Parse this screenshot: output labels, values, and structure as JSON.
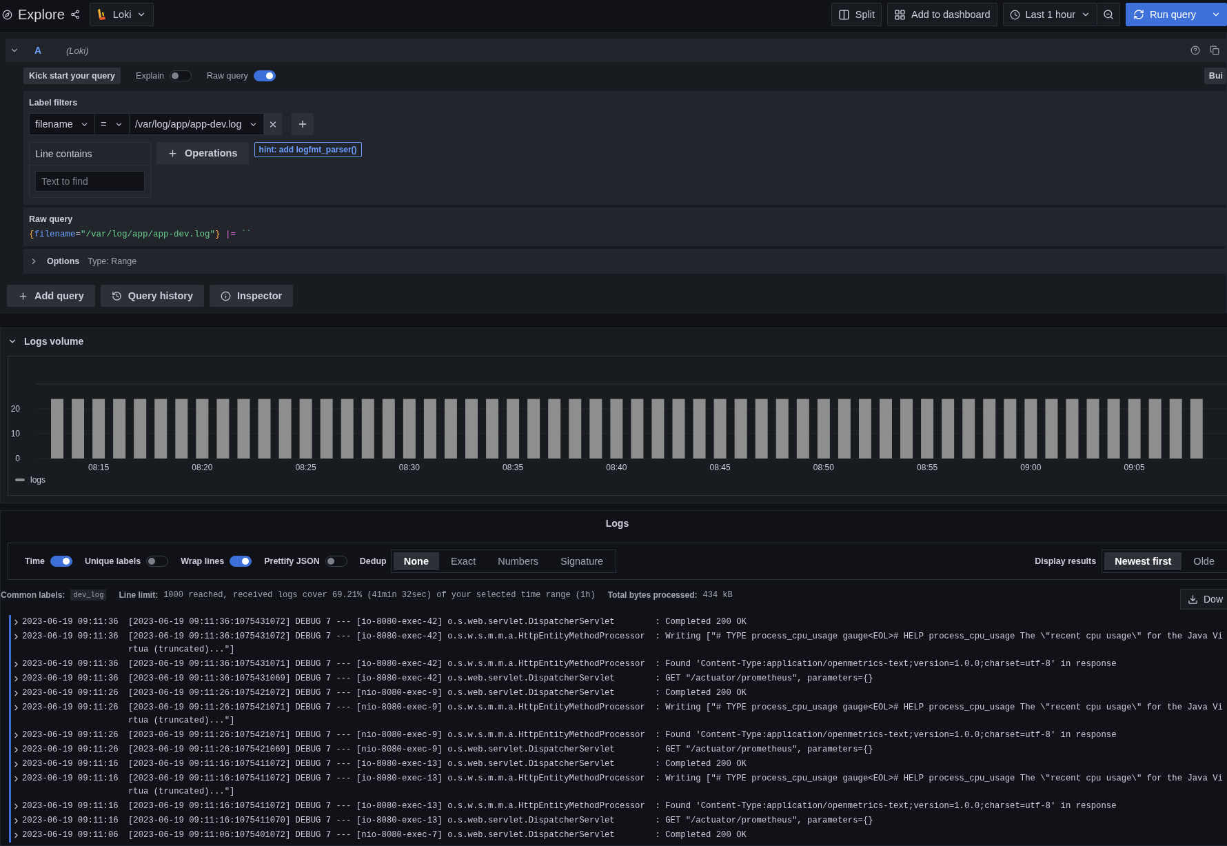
{
  "toolbar": {
    "title": "Explore",
    "datasource": "Loki",
    "buttons": [
      {
        "kind": "split",
        "label": "Split"
      },
      {
        "kind": "dashboard",
        "label": "Add to dashboard"
      },
      {
        "kind": "time",
        "label": "Last 1 hour"
      }
    ],
    "run_label": "Run query"
  },
  "query": {
    "ref": "A",
    "datasource": "(Loki)",
    "kickstart": "Kick start your query",
    "toggles": [
      {
        "label": "Explain",
        "on": false
      },
      {
        "label": "Raw query",
        "on": true
      }
    ],
    "mode_button": "Bui",
    "label_filters": {
      "title": "Label filters",
      "label": "filename",
      "operator": "=",
      "value": "/var/log/app/app-dev.log"
    },
    "line_contains": {
      "title": "Line contains",
      "placeholder": "Text to find"
    },
    "operations": "Operations",
    "hint": "hint: add logfmt_parser()",
    "raw_query": {
      "title": "Raw query",
      "tokens": [
        {
          "kind": "brace",
          "text": "{"
        },
        {
          "kind": "label",
          "text": "filename"
        },
        {
          "kind": "op",
          "text": "="
        },
        {
          "kind": "string",
          "text": "\"/var/log/app/app-dev.log\""
        },
        {
          "kind": "brace",
          "text": "}"
        },
        {
          "kind": "pipe",
          "text": "|="
        },
        {
          "kind": "string",
          "text": "``"
        }
      ]
    },
    "options": {
      "title": "Options",
      "summary": "Type: Range",
      "expanded": false
    }
  },
  "actions": [
    {
      "kind": "add",
      "label": "Add query"
    },
    {
      "kind": "history",
      "label": "Query history"
    },
    {
      "kind": "info",
      "label": "Inspector"
    }
  ],
  "logs_volume": {
    "title": "Logs volume",
    "expanded": true,
    "chart_data": {
      "type": "bar",
      "categories": [
        null,
        null,
        "08:15",
        null,
        null,
        null,
        null,
        "08:20",
        null,
        null,
        null,
        null,
        "08:25",
        null,
        null,
        null,
        null,
        "08:30",
        null,
        null,
        null,
        null,
        "08:35",
        null,
        null,
        null,
        null,
        "08:40",
        null,
        null,
        null,
        null,
        "08:45",
        null,
        null,
        null,
        null,
        "08:50",
        null,
        null,
        null,
        null,
        "08:55",
        null,
        null,
        null,
        null,
        "09:00",
        null,
        null,
        null,
        null,
        "09:05",
        null,
        null,
        null
      ],
      "series": [
        {
          "name": "logs",
          "color": "#8e8e8e",
          "values": [
            24,
            24,
            24,
            24,
            24,
            24,
            24,
            24,
            24,
            24,
            24,
            24,
            24,
            24,
            24,
            24,
            24,
            24,
            24,
            24,
            24,
            24,
            24,
            24,
            24,
            24,
            24,
            24,
            24,
            24,
            24,
            24,
            24,
            24,
            24,
            24,
            24,
            24,
            24,
            24,
            24,
            24,
            24,
            24,
            24,
            24,
            24,
            24,
            24,
            24,
            24,
            24,
            24,
            24,
            24,
            24
          ]
        }
      ],
      "ylim": [
        0,
        30
      ],
      "yticks": [
        0,
        10,
        20
      ]
    }
  },
  "logs": {
    "title": "Logs",
    "settings": [
      {
        "label": "Time",
        "on": true
      },
      {
        "label": "Unique labels",
        "on": false
      },
      {
        "label": "Wrap lines",
        "on": true
      },
      {
        "label": "Prettify JSON",
        "on": false
      }
    ],
    "dedup": {
      "label": "Dedup",
      "options": [
        {
          "label": "None",
          "selected": true
        },
        {
          "label": "Exact",
          "selected": false
        },
        {
          "label": "Numbers",
          "selected": false
        },
        {
          "label": "Signature",
          "selected": false
        }
      ]
    },
    "order": {
      "label": "Display results",
      "options": [
        {
          "label": "Newest first",
          "selected": true
        },
        {
          "label": "Olde",
          "selected": false
        }
      ]
    },
    "meta": [
      {
        "kind": "tag",
        "label": "Common labels:",
        "value": "dev_log"
      },
      {
        "kind": "mono",
        "label": "Line limit:",
        "value": "1000 reached, received logs cover 69.21% (41min 32sec) of your selected time range (1h)"
      },
      {
        "kind": "mono",
        "label": "Total bytes processed:",
        "value": "434 kB"
      }
    ],
    "download": "Dow",
    "rows": [
      {
        "time": "2023-06-19 09:11:36",
        "lines": [
          "[2023-06-19 09:11:36:1075431072] DEBUG 7 --- [io-8080-exec-42] o.s.web.servlet.DispatcherServlet        : Completed 200 OK"
        ]
      },
      {
        "time": "2023-06-19 09:11:36",
        "lines": [
          "[2023-06-19 09:11:36:1075431072] DEBUG 7 --- [io-8080-exec-42] o.s.w.s.m.m.a.HttpEntityMethodProcessor  : Writing [\"# TYPE process_cpu_usage gauge<EOL># HELP process_cpu_usage The \\\"recent cpu usage\\\" for the Java Vi",
          "rtua (truncated)...\"]"
        ]
      },
      {
        "time": "2023-06-19 09:11:36",
        "lines": [
          "[2023-06-19 09:11:36:1075431071] DEBUG 7 --- [io-8080-exec-42] o.s.w.s.m.m.a.HttpEntityMethodProcessor  : Found 'Content-Type:application/openmetrics-text;version=1.0.0;charset=utf-8' in response"
        ]
      },
      {
        "time": "2023-06-19 09:11:36",
        "lines": [
          "[2023-06-19 09:11:36:1075431069] DEBUG 7 --- [io-8080-exec-42] o.s.web.servlet.DispatcherServlet        : GET \"/actuator/prometheus\", parameters={}"
        ]
      },
      {
        "time": "2023-06-19 09:11:26",
        "lines": [
          "[2023-06-19 09:11:26:1075421072] DEBUG 7 --- [nio-8080-exec-9] o.s.web.servlet.DispatcherServlet        : Completed 200 OK"
        ]
      },
      {
        "time": "2023-06-19 09:11:26",
        "lines": [
          "[2023-06-19 09:11:26:1075421071] DEBUG 7 --- [nio-8080-exec-9] o.s.w.s.m.m.a.HttpEntityMethodProcessor  : Writing [\"# TYPE process_cpu_usage gauge<EOL># HELP process_cpu_usage The \\\"recent cpu usage\\\" for the Java Vi",
          "rtua (truncated)...\"]"
        ]
      },
      {
        "time": "2023-06-19 09:11:26",
        "lines": [
          "[2023-06-19 09:11:26:1075421071] DEBUG 7 --- [nio-8080-exec-9] o.s.w.s.m.m.a.HttpEntityMethodProcessor  : Found 'Content-Type:application/openmetrics-text;version=1.0.0;charset=utf-8' in response"
        ]
      },
      {
        "time": "2023-06-19 09:11:26",
        "lines": [
          "[2023-06-19 09:11:26:1075421069] DEBUG 7 --- [nio-8080-exec-9] o.s.web.servlet.DispatcherServlet        : GET \"/actuator/prometheus\", parameters={}"
        ]
      },
      {
        "time": "2023-06-19 09:11:16",
        "lines": [
          "[2023-06-19 09:11:16:1075411072] DEBUG 7 --- [io-8080-exec-13] o.s.web.servlet.DispatcherServlet        : Completed 200 OK"
        ]
      },
      {
        "time": "2023-06-19 09:11:16",
        "lines": [
          "[2023-06-19 09:11:16:1075411072] DEBUG 7 --- [io-8080-exec-13] o.s.w.s.m.m.a.HttpEntityMethodProcessor  : Writing [\"# TYPE process_cpu_usage gauge<EOL># HELP process_cpu_usage The \\\"recent cpu usage\\\" for the Java Vi",
          "rtua (truncated)...\"]"
        ]
      },
      {
        "time": "2023-06-19 09:11:16",
        "lines": [
          "[2023-06-19 09:11:16:1075411072] DEBUG 7 --- [io-8080-exec-13] o.s.w.s.m.m.a.HttpEntityMethodProcessor  : Found 'Content-Type:application/openmetrics-text;version=1.0.0;charset=utf-8' in response"
        ]
      },
      {
        "time": "2023-06-19 09:11:16",
        "lines": [
          "[2023-06-19 09:11:16:1075411070] DEBUG 7 --- [io-8080-exec-13] o.s.web.servlet.DispatcherServlet        : GET \"/actuator/prometheus\", parameters={}"
        ]
      },
      {
        "time": "2023-06-19 09:11:06",
        "lines": [
          "[2023-06-19 09:11:06:1075401072] DEBUG 7 --- [nio-8080-exec-7] o.s.web.servlet.DispatcherServlet        : Completed 200 OK"
        ]
      }
    ]
  }
}
